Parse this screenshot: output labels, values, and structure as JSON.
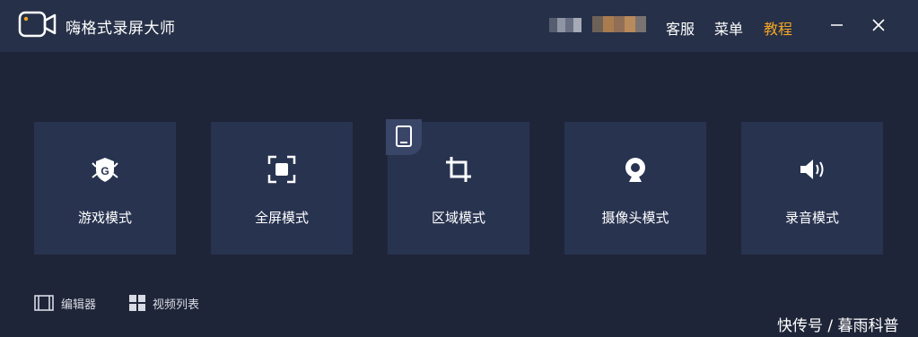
{
  "app": {
    "title": "嗨格式录屏大师"
  },
  "header": {
    "links": [
      {
        "label": "客服",
        "color": "#ffffff"
      },
      {
        "label": "菜单",
        "color": "#ffffff"
      },
      {
        "label": "教程",
        "color": "#f5a623"
      }
    ],
    "window_controls": [
      "minimize-icon",
      "close-icon"
    ]
  },
  "modes": [
    {
      "label": "游戏模式",
      "icon": "game-shield-icon"
    },
    {
      "label": "全屏模式",
      "icon": "fullscreen-icon"
    },
    {
      "label": "区域模式",
      "icon": "crop-icon"
    },
    {
      "label": "摄像头模式",
      "icon": "webcam-icon"
    },
    {
      "label": "录音模式",
      "icon": "speaker-icon"
    }
  ],
  "badge": {
    "icon": "tablet-icon"
  },
  "bottom": [
    {
      "label": "编辑器",
      "icon": "film-editor-icon"
    },
    {
      "label": "视频列表",
      "icon": "grid-list-icon"
    }
  ],
  "watermark": "快传号 / 暮雨科普",
  "colors": {
    "background": "#1f2538",
    "titlebar": "#263048",
    "card": "#283350",
    "accent": "#f5a623"
  }
}
